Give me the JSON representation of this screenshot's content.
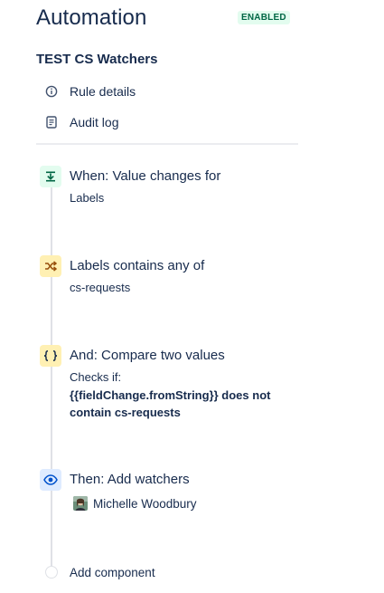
{
  "header": {
    "title": "Automation",
    "status": "ENABLED"
  },
  "rule": {
    "name": "TEST CS Watchers"
  },
  "links": {
    "details": "Rule details",
    "audit": "Audit log"
  },
  "steps": {
    "trigger": {
      "title": "When: Value changes for",
      "detail": "Labels",
      "icon": "field-change-icon"
    },
    "condition": {
      "title": "Labels contains any of",
      "detail": "cs-requests",
      "icon": "shuffle-icon"
    },
    "compare": {
      "title": "And: Compare two values",
      "checks": "Checks if:",
      "expression": "{{fieldChange.fromString}} does not contain cs-requests",
      "icon": "braces-icon"
    },
    "action": {
      "title": "Then: Add watchers",
      "watcher": "Michelle Woodbury",
      "icon": "eye-icon"
    }
  },
  "add_component": "Add component",
  "colors": {
    "enabled_bg": "#e3fcef",
    "enabled_text": "#006644",
    "trigger_bg": "#e3fcef",
    "condition_bg": "#fff0b3",
    "action_bg": "#deebff"
  }
}
